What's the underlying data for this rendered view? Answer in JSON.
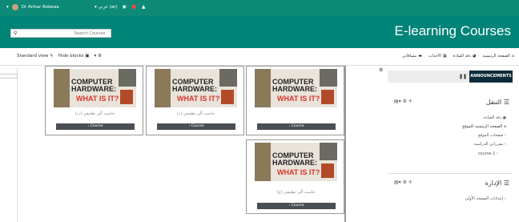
{
  "topbar": {
    "user_name": "Dr Anhar Robeaa",
    "language": "عربي (ar)",
    "icons": [
      "globe-icon",
      "chat-icon",
      "bell-icon"
    ],
    "color": "#0d8a78"
  },
  "header": {
    "search_placeholder": "Search Courses",
    "brand": "E-learning Courses",
    "color": "#008478"
  },
  "toolbar": {
    "standard_view": "Standard view",
    "hide_blocks": "Hide blocks",
    "gear": "gear-icon"
  },
  "nav": {
    "items": [
      {
        "label": "الصفحة الرئيسية",
        "icon": "home-icon"
      },
      {
        "label": "دفة القيادة",
        "icon": "dashboard-icon"
      },
      {
        "label": "الأحداث",
        "icon": "calendar-icon"
      },
      {
        "label": "مساقاتي",
        "icon": "briefcase-icon"
      }
    ]
  },
  "courses": [
    {
      "title1": "COMPUTER",
      "title2": "HARDWARE:",
      "subtitle": "WHAT IS IT?",
      "name": "حاسب آلي تطبيقي (ب)",
      "button": "Course"
    },
    {
      "title1": "COMPUTER",
      "title2": "HARDWARE:",
      "subtitle": "WHAT IS IT?",
      "name": "حاسب آلي تطبيقي (د)",
      "button": "Course"
    },
    {
      "title1": "COMPUTER",
      "title2": "HARDWARE:",
      "subtitle": "WHAT IS IT?",
      "name": "",
      "button": "Course"
    },
    {
      "title1": "COMPUTER",
      "title2": "HARDWARE:",
      "subtitle": "WHAT IS IT?",
      "name": "حاسب آلي تطبيقي (ج)",
      "button": "Course"
    }
  ],
  "sidebar": {
    "announcements": "ANNOUNCEMENTS",
    "nav_block": {
      "title": "التنقل",
      "items": [
        "دفة القيادة",
        "الصفحة الرئيسية للموقع",
        "صفحات الموقع",
        "مقرراتي الدراسية",
        "course-1"
      ]
    },
    "admin_block": {
      "title": "الإدارة",
      "items": [
        "إعدادات الصفحة الأولى"
      ]
    }
  }
}
